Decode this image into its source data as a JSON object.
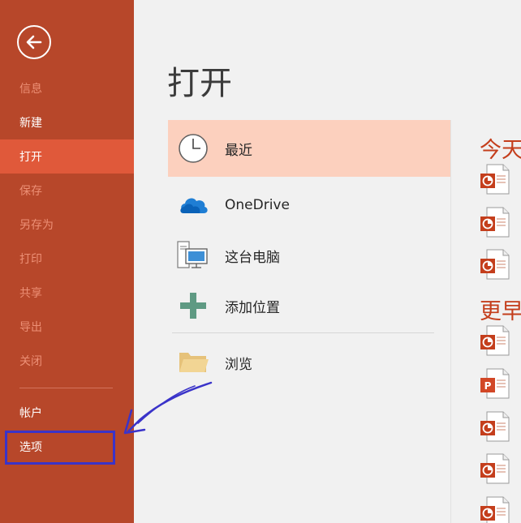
{
  "sidebar": {
    "items": [
      {
        "label": "信息"
      },
      {
        "label": "新建"
      },
      {
        "label": "打开"
      },
      {
        "label": "保存"
      },
      {
        "label": "另存为"
      },
      {
        "label": "打印"
      },
      {
        "label": "共享"
      },
      {
        "label": "导出"
      },
      {
        "label": "关闭"
      },
      {
        "label": "帐户"
      },
      {
        "label": "选项"
      }
    ],
    "active_item": "打开",
    "color": "#b7472a",
    "active_color": "#e0593a"
  },
  "page": {
    "title": "打开"
  },
  "locations": [
    {
      "label": "最近",
      "icon": "clock-icon",
      "selected": true
    },
    {
      "label": "OneDrive",
      "icon": "onedrive-cloud-icon"
    },
    {
      "label": "这台电脑",
      "icon": "computer-icon"
    },
    {
      "label": "添加位置",
      "icon": "plus-icon"
    },
    {
      "label": "浏览",
      "icon": "folder-icon"
    }
  ],
  "recent": {
    "sections": [
      {
        "heading": "今天",
        "files": [
          "pptx-file-icon",
          "pptx-file-icon",
          "pptx-file-icon"
        ]
      },
      {
        "heading": "更早",
        "files": [
          "pptx-file-icon",
          "ppt-file-icon",
          "pptx-file-icon",
          "pptx-file-icon",
          "pptx-file-icon"
        ]
      }
    ]
  },
  "colors": {
    "accent": "#c43e1c",
    "selected_location": "#fcd0be",
    "annotation": "#3a33c9"
  }
}
